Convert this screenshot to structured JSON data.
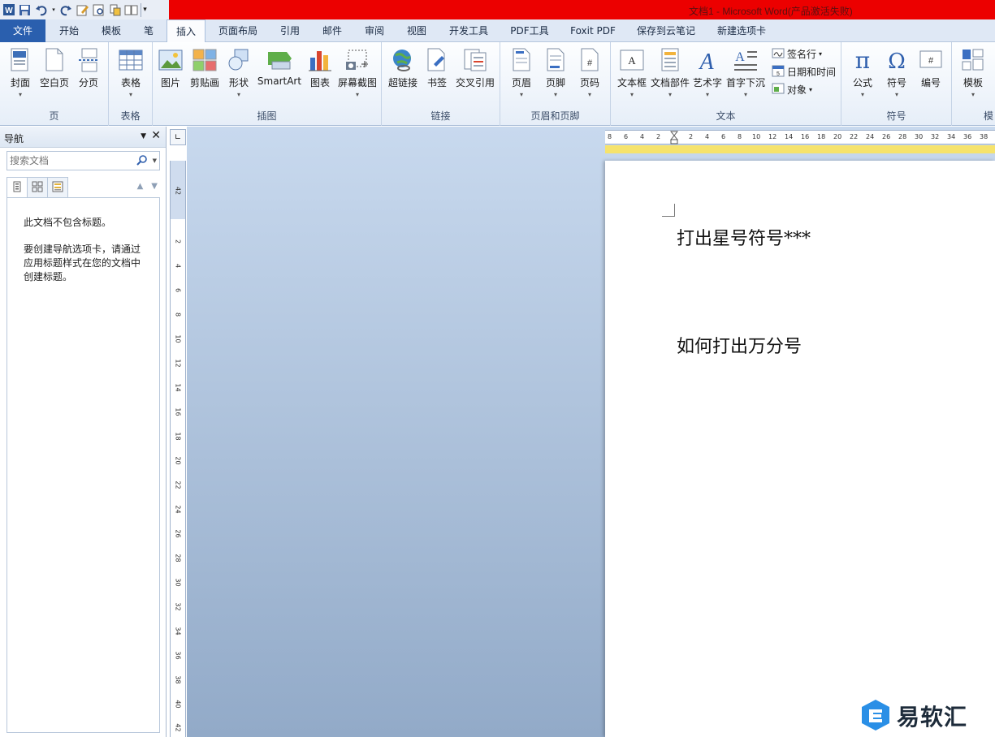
{
  "window": {
    "title": "文档1 - Microsoft Word(产品激活失败)"
  },
  "tabs": [
    {
      "label": "文件"
    },
    {
      "label": "开始"
    },
    {
      "label": "模板"
    },
    {
      "label": "笔"
    },
    {
      "label": "插入"
    },
    {
      "label": "页面布局"
    },
    {
      "label": "引用"
    },
    {
      "label": "邮件"
    },
    {
      "label": "审阅"
    },
    {
      "label": "视图"
    },
    {
      "label": "开发工具"
    },
    {
      "label": "PDF工具"
    },
    {
      "label": "Foxit PDF"
    },
    {
      "label": "保存到云笔记"
    },
    {
      "label": "新建选项卡"
    }
  ],
  "ribbon": {
    "page_group": {
      "label": "页",
      "cover": "封面",
      "blank": "空白页",
      "break": "分页"
    },
    "table_group": {
      "label": "表格",
      "table": "表格"
    },
    "illus_group": {
      "label": "插图",
      "picture": "图片",
      "clipart": "剪贴画",
      "shapes": "形状",
      "smartart": "SmartArt",
      "chart": "图表",
      "screenshot": "屏幕截图"
    },
    "link_group": {
      "label": "链接",
      "hyperlink": "超链接",
      "bookmark": "书签",
      "crossref": "交叉引用"
    },
    "hf_group": {
      "label": "页眉和页脚",
      "header": "页眉",
      "footer": "页脚",
      "pagenum": "页码"
    },
    "text_group": {
      "label": "文本",
      "textbox": "文本框",
      "quickparts": "文档部件",
      "wordart": "艺术字",
      "dropcap": "首字下沉",
      "signature": "签名行",
      "datetime": "日期和时间",
      "object": "对象"
    },
    "symbol_group": {
      "label": "符号",
      "equation": "公式",
      "symbol": "符号",
      "number": "编号"
    },
    "template_group": {
      "label": "模",
      "template": "模板"
    }
  },
  "nav": {
    "title": "导航",
    "search_placeholder": "搜索文档",
    "msg1": "此文档不包含标题。",
    "msg2": "要创建导航选项卡，请通过应用标题样式在您的文档中创建标题。"
  },
  "vruler": [
    "4",
    "2",
    "2",
    "4",
    "6",
    "8",
    "10",
    "12",
    "14",
    "16",
    "18",
    "20",
    "22",
    "24",
    "26",
    "28",
    "30",
    "32",
    "34",
    "36",
    "38",
    "40",
    "42"
  ],
  "hruler": [
    "8",
    "6",
    "4",
    "2",
    "2",
    "4",
    "6",
    "8",
    "10",
    "12",
    "14",
    "16",
    "18",
    "20",
    "22",
    "24",
    "26",
    "28",
    "30",
    "32",
    "34",
    "36",
    "38"
  ],
  "document": {
    "line1": "打出星号符号***",
    "line2": "如何打出万分号"
  },
  "watermark": {
    "text": "易软汇"
  }
}
